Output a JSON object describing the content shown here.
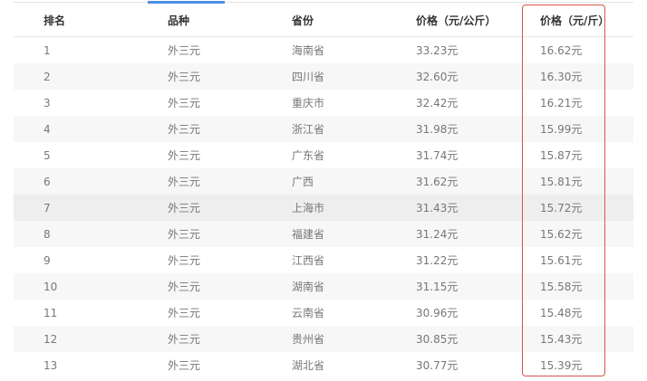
{
  "table": {
    "headers": [
      "排名",
      "品种",
      "省份",
      "价格（元/公斤）",
      "价格（元/斤）"
    ],
    "rows": [
      [
        "1",
        "外三元",
        "海南省",
        "33.23元",
        "16.62元"
      ],
      [
        "2",
        "外三元",
        "四川省",
        "32.60元",
        "16.30元"
      ],
      [
        "3",
        "外三元",
        "重庆市",
        "32.42元",
        "16.21元"
      ],
      [
        "4",
        "外三元",
        "浙江省",
        "31.98元",
        "15.99元"
      ],
      [
        "5",
        "外三元",
        "广东省",
        "31.74元",
        "15.87元"
      ],
      [
        "6",
        "外三元",
        "广西",
        "31.62元",
        "15.81元"
      ],
      [
        "7",
        "外三元",
        "上海市",
        "31.43元",
        "15.72元"
      ],
      [
        "8",
        "外三元",
        "福建省",
        "31.24元",
        "15.62元"
      ],
      [
        "9",
        "外三元",
        "江西省",
        "31.22元",
        "15.61元"
      ],
      [
        "10",
        "外三元",
        "湖南省",
        "31.15元",
        "15.58元"
      ],
      [
        "11",
        "外三元",
        "云南省",
        "30.96元",
        "15.48元"
      ],
      [
        "12",
        "外三元",
        "贵州省",
        "30.85元",
        "15.43元"
      ],
      [
        "13",
        "外三元",
        "湖北省",
        "30.77元",
        "15.39元"
      ]
    ],
    "hovered_row": 7
  },
  "colors": {
    "accent": "#4a90e2",
    "highlight_border": "#d9534f",
    "header_text": "#333333",
    "cell_text": "#777777"
  }
}
